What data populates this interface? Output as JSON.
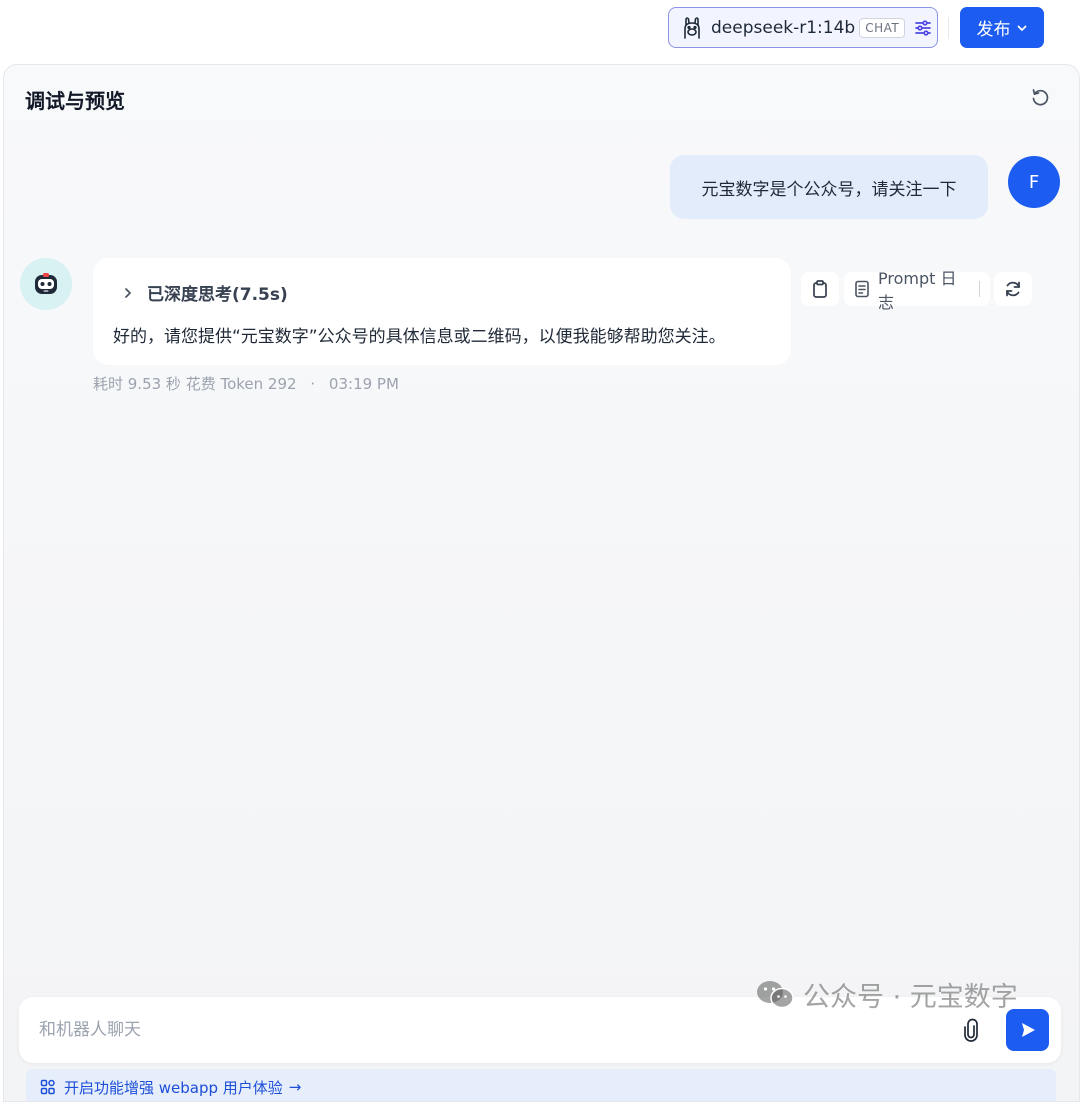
{
  "header": {
    "model_name": "deepseek-r1:14b",
    "model_tag": "CHAT",
    "publish_label": "发布"
  },
  "panel": {
    "title": "调试与预览"
  },
  "conversation": {
    "user_message": {
      "avatar_letter": "F",
      "text": "元宝数字是个公众号，请关注一下"
    },
    "bot_message": {
      "thinking_label": "已深度思考(7.5s)",
      "text": "好的，请您提供“元宝数字”公众号的具体信息或二维码，以便我能够帮助您关注。",
      "actions": {
        "prompt_log_label": "Prompt 日志"
      },
      "meta": {
        "duration": "耗时 9.53 秒",
        "tokens": "花费 Token 292",
        "separator": "·",
        "time": "03:19 PM"
      }
    }
  },
  "composer": {
    "placeholder": "和机器人聊天",
    "enhance_text": "开启功能增强 webapp 用户体验",
    "enhance_arrow": "→"
  },
  "watermark": {
    "text": "公众号 · 元宝数字"
  },
  "colors": {
    "accent": "#1d5cf0",
    "user_bubble": "#e2ecfb",
    "enhance_bar": "#e6eefb"
  }
}
